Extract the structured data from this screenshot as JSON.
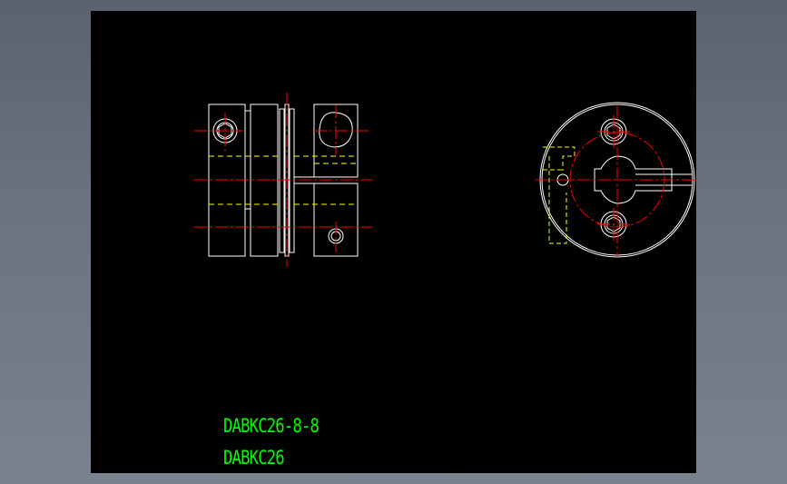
{
  "colors": {
    "outline": "#ffffff",
    "centerline": "#ff0000",
    "hidden": "#ffff00",
    "text": "#00ff00",
    "background": "#000000"
  },
  "labels": {
    "part_number": "DABKC26-8-8",
    "series": "DABKC26"
  }
}
